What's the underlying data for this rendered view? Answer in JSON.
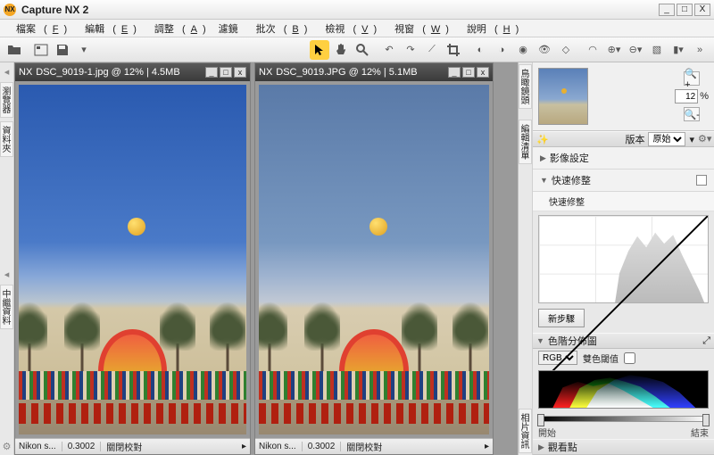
{
  "app": {
    "title": "Capture NX 2",
    "icon_text": "NX"
  },
  "window_buttons": {
    "min": "_",
    "max": "□",
    "close": "X"
  },
  "menu": [
    {
      "label": "檔案",
      "accel": "F"
    },
    {
      "label": "編輯",
      "accel": "E"
    },
    {
      "label": "調整",
      "accel": "A"
    },
    {
      "label": "濾鏡",
      "accel": ""
    },
    {
      "label": "批次",
      "accel": "B"
    },
    {
      "label": "檢視",
      "accel": "V"
    },
    {
      "label": "視窗",
      "accel": "W"
    },
    {
      "label": "說明",
      "accel": "H"
    }
  ],
  "left_rail": {
    "tabs": [
      "瀏覽器",
      "資料夾",
      "中繼資料"
    ]
  },
  "right_rail": {
    "tabs": [
      "鳥瞰鏡頭",
      "編輯清單",
      "相片資訊"
    ]
  },
  "documents": [
    {
      "title": "DSC_9019-1.jpg @ 12% | 4.5MB",
      "status_left": "Nikon s...",
      "status_mid": "0.3002",
      "status_right": "關閉校對"
    },
    {
      "title": "DSC_9019.JPG @ 12% | 5.1MB",
      "status_left": "Nikon s...",
      "status_mid": "0.3002",
      "status_right": "關閉校對"
    }
  ],
  "navigator": {
    "zoom_value": "12",
    "zoom_unit": "%"
  },
  "edit_panel": {
    "version_label": "版本",
    "version_value": "原始",
    "section1": "影像設定",
    "section2": "快速修整",
    "subitem": "快速修整",
    "new_step": "新步驟"
  },
  "histogram_panel": {
    "title": "色階分佈圖",
    "channel": "RGB",
    "threshold_label": "雙色閾值",
    "start": "開始",
    "end": "結束"
  },
  "watchpoints": {
    "title": "觀看點"
  }
}
